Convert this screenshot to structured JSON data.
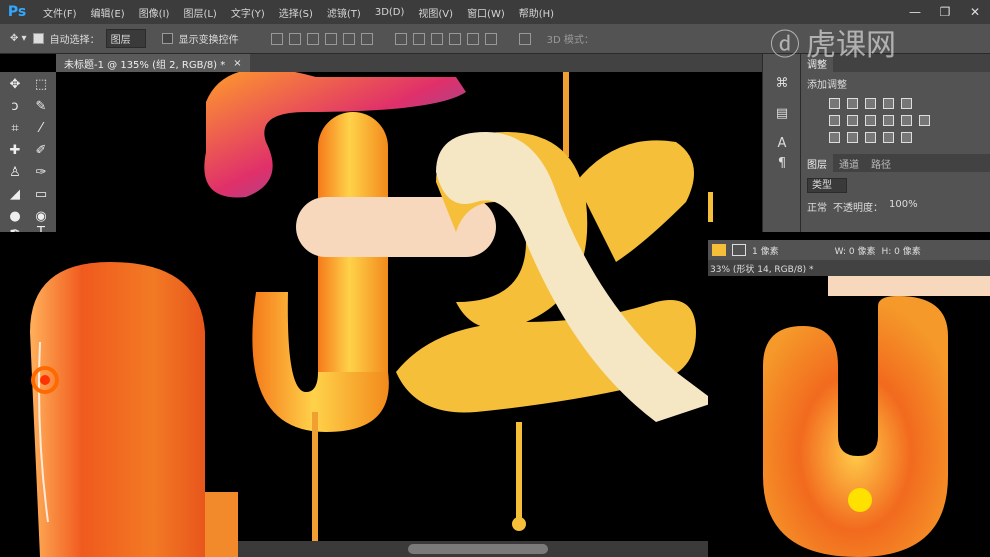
{
  "app": {
    "logo": "Ps"
  },
  "menu": [
    "文件(F)",
    "编辑(E)",
    "图像(I)",
    "图层(L)",
    "文字(Y)",
    "选择(S)",
    "滤镜(T)",
    "3D(D)",
    "视图(V)",
    "窗口(W)",
    "帮助(H)"
  ],
  "window_controls": {
    "minimize": "—",
    "restore": "❐",
    "close": "✕"
  },
  "options": {
    "auto_select_label": "自动选择：",
    "auto_select_value": "图层",
    "show_transform_label": "显示变换控件",
    "mode_3d_label": "3D 模式："
  },
  "document": {
    "tab_title": "未标题-1 @ 135% (组 2, RGB/8) *",
    "close": "×"
  },
  "panels": {
    "tabs_top": [
      "调整"
    ],
    "add_adjustment": "添加调整",
    "tabs_layers": [
      "图层",
      "通道",
      "路径"
    ],
    "filter_kind": "类型",
    "blend_mode": "正常",
    "opacity_label": "不透明度：",
    "opacity_value": "100%"
  },
  "overlay_right": {
    "tab_title": "33% (形状 14, RGB/8) *",
    "stroke_label": "1 像素",
    "w_label": "W: 0 像素",
    "h_label": "H: 0 像素"
  },
  "watermark": {
    "text": "虎课网"
  },
  "colors": {
    "menubar": "#3c3c3c",
    "panel": "#535353",
    "canvas_bg": "#000000",
    "letter_orange": "#f39a1f",
    "letter_yellow": "#f6bf3a",
    "cream": "#f5e6c4",
    "ps_blue": "#31a8ff"
  }
}
